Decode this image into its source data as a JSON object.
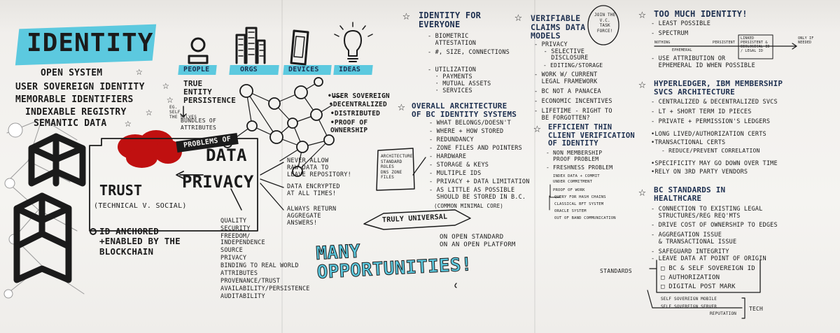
{
  "title": "IDENTITY",
  "system_list": [
    "OPEN SYSTEM",
    "USER SOVEREIGN IDENTITY",
    "MEMORABLE IDENTIFIERS",
    "INDEXABLE REGISTRY",
    "SEMANTIC DATA"
  ],
  "entities": [
    "PEOPLE",
    "ORGS",
    "DEVICES",
    "IDEAS"
  ],
  "entity_notes": {
    "true_entity": "TRUE\nENTITY\nPERSISTENCE",
    "bundles": "BUNDLES of\nATTRIBUTES",
    "side_note": "Eg.\nSELF\nTHE SELVES"
  },
  "network_props": [
    "•USER SOVEREIGN",
    "•DECENTRALIZED",
    "•DISTRIBUTED",
    "•PROOF of\nOWNERSHIP"
  ],
  "problems_of": "PROBLEMS of",
  "data_privacy": {
    "data": "DATA",
    "privacy": "PRIVACY",
    "trust": "TRUST",
    "trust_sub": "(TECHNICAL v. SOCIAL)"
  },
  "anchored": "ID ANCHORED\n+ENABLED BY the\nBLOCKCHAIN",
  "privacy_rules": [
    "NEVER ALLOW\nRAW DATA to\nLEAVE REPOSITORY!",
    "DATA ENCRYPTED\nat ALL TIMES!",
    "ALWAYS RETURN\nAGGREGATE\nANSWERS!"
  ],
  "qualities": [
    "QUALITY",
    "SECURITY",
    "FREEDOM/\nINDEPENDENCE",
    "SOURCE",
    "PRIVACY",
    "BINDING to REAL WORLD",
    "ATTRIBUTES",
    "PROVENANCE/TRUST",
    "AVAILABILITY/PERSISTENCE",
    "AUDITABILITY"
  ],
  "identity_for_everyone": {
    "title": "IDENTITY for\nEVERYONE",
    "items": [
      "- BIOMETRIC\n  ATTESTATION",
      "- #, SIZE, CONNECTIONS",
      "- UTILIZATION",
      "  · PAYMENTS",
      "  · MUTUAL ASSETS",
      "  · SERVICES"
    ]
  },
  "overall_arch": {
    "title": "OVERALL ARCHITECTURE\nof BC IDENTITY SYSTEMS",
    "items": [
      "- WHAT BELONGS/DOESN'T",
      "- WHERE + HOW STORED",
      "- REDUNDANCY",
      "- ZONE FILES and POINTERS",
      "- HARDWARE",
      "- STORAGE & KEYS",
      "- MULTIPLE IDs",
      "- PRIVACY + DATA LIMITATION",
      "- AS LITTLE AS POSSIBLE\n  SHOULD BE STORED in B.C.",
      "(COMMON MINIMAL CORE)"
    ],
    "box": "ARCHITECTURE\nSTANDARD\nROLES\nDNS ZONE\nFILES"
  },
  "truly_universal": "TRULY UNIVERSAL",
  "open_standard": "on OPEN STANDARD\non an OPEN PLATFORM",
  "many_opportunities": "MANY\nOPPORTUNITIES!",
  "verifiable": {
    "title": "VERIFIABLE\nCLAIMS DATA\nMODELS",
    "join": "JOIN the\nV.C.\nTASK\nFORCE!",
    "items": [
      "- PRIVACY",
      "  - SELECTIVE\n    DISCLOSURE",
      "  - EDITING/STORAGE",
      "- WORK w/ CURRENT\n  LEGAL FRAMEWORK",
      "- BC not a PANACEA",
      "- ECONOMIC INCENTIVES",
      "- LIFETIME - RIGHT to\n  BE FORGOTTEN?"
    ]
  },
  "efficient": {
    "title": "EFFICIENT THIN\nCLIENT VERIFICATION\nof IDENTITY",
    "items": [
      "- NON MEMBERSHIP\n  PROOF PROBLEM",
      "- FRESHNESS PROBLEM"
    ],
    "small": [
      "INDEX DATA + COMMIT",
      "UNDER COMMITMENT",
      "PROOF of WORK",
      "QUERY for HASH CHAINS",
      "CLASSICAL BFT SYSTEM",
      "ORACLE SYSTEM",
      "OUT of BAND COMMUNICATION"
    ]
  },
  "too_much": {
    "title": "TOO MUCH IDENTITY!",
    "items": [
      "- LEAST POSSIBLE",
      "- SPECTRUM"
    ],
    "spectrum": [
      "NOTHING",
      "EPHEMERAL",
      "PERSISTENT",
      "LINKED\nPERSISTENT &\nBIOLOGICAL ID\n/ LEGAL ID",
      "ONLY if\nNEEDED"
    ],
    "use": "- USE ATTRIBUTION OR\n  EPHEMERAL ID WHEN POSSIBLE"
  },
  "hyperledger": {
    "title": "HYPERLEDGER, IBM MEMBERSHIP\nSVCS ARCHITECTURE",
    "items": [
      "- CENTRALIZED & DECENTRALIZED SVCS",
      "- LT + SHORT TERM ID PIECES",
      "- PRIVATE + PERMISSION'S LEDGERS",
      "•LONG LIVED/AUTHORIZATION CERTS",
      "•TRANSACTIONAL CERTS",
      "   - REDUCE/PREVENT CORRELATION",
      "•SPECIFICITY MAY GO DOWN OVER TIME",
      "•RELY on 3RD PARTY VENDORS"
    ]
  },
  "healthcare": {
    "title": "BC STANDARDS in\nHEALTHCARE",
    "items": [
      "- CONNECTION to EXISTING LEGAL\n  STRUCTURES/REG REQ'MTS",
      "- DRIVE COST of OWNERSHIP to EDGES",
      "- AGGREGATION ISSUE\n  & TRANSACTIONAL ISSUE",
      "- SAFEGUARD INTEGRITY",
      "- LEAVE DATA at POINT of ORIGIN"
    ],
    "standards_label": "STANDARDS",
    "standards": [
      "□ BC & SELF SOVEREIGN ID",
      "□ AUTHORIZATION",
      "□ DIGITAL POST MARK"
    ],
    "tech": [
      "SELF SOVEREIGN MOBILE",
      "SELF SOVEREIGN SERVER",
      "REPUTATION"
    ],
    "tech_label": "TECH"
  },
  "colors": {
    "accent": "#5cc9df",
    "ink": "#1b1b1b",
    "navy": "#1e3050",
    "red": "#c01010"
  }
}
